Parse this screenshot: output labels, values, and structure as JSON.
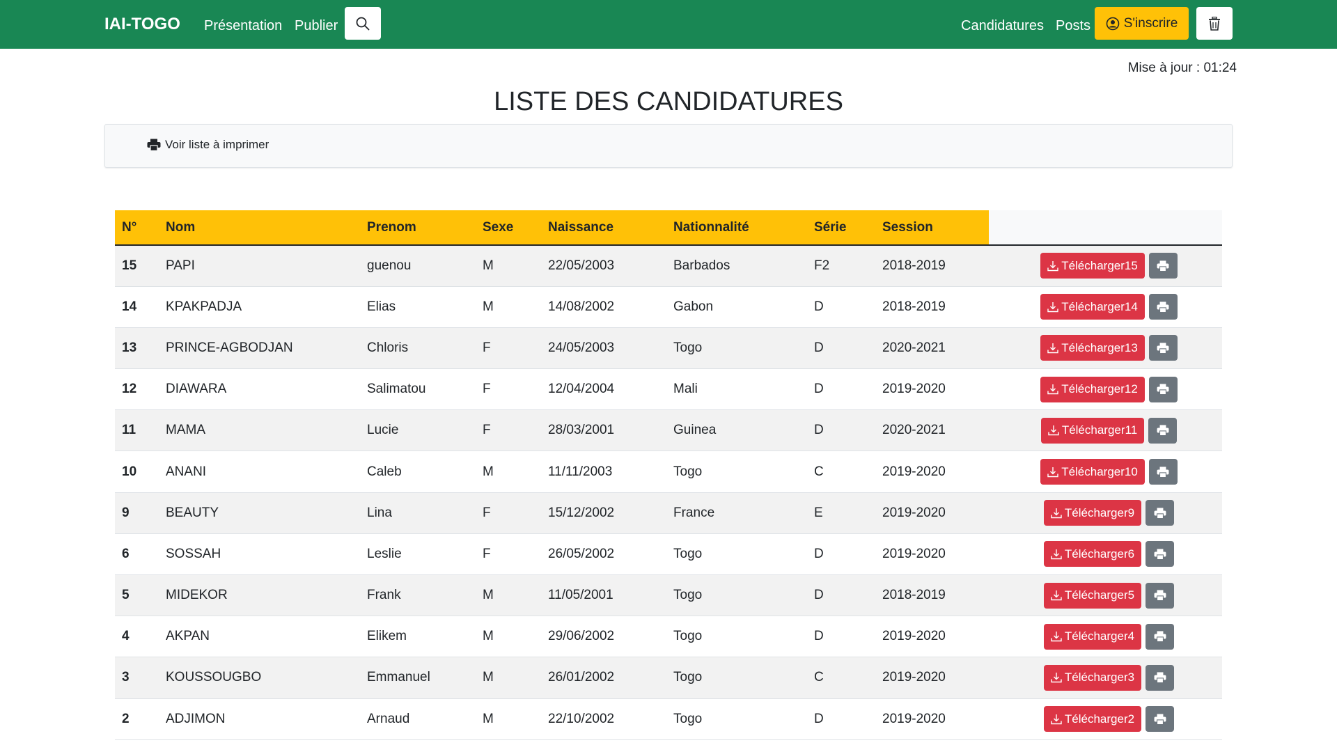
{
  "nav": {
    "brand": "IAI-TOGO",
    "presentation": "Présentation",
    "publier": "Publier",
    "candidatures": "Candidatures",
    "posts": "Posts",
    "signup": "S'inscrire"
  },
  "update_time": "Mise à jour : 01:24",
  "page_title": "LISTE DES CANDIDATURES",
  "print_list_label": "Voir liste à imprimer",
  "table": {
    "headers": [
      "N°",
      "Nom",
      "Prenom",
      "Sexe",
      "Naissance",
      "Nationnalité",
      "Série",
      "Session"
    ],
    "rows": [
      {
        "n": "15",
        "nom": "PAPI",
        "prenom": "guenou",
        "sexe": "M",
        "naissance": "22/05/2003",
        "nat": "Barbados",
        "serie": "F2",
        "session": "2018-2019",
        "dl": "Télécharger15"
      },
      {
        "n": "14",
        "nom": "KPAKPADJA",
        "prenom": "Elias",
        "sexe": "M",
        "naissance": "14/08/2002",
        "nat": "Gabon",
        "serie": "D",
        "session": "2018-2019",
        "dl": "Télécharger14"
      },
      {
        "n": "13",
        "nom": "PRINCE-AGBODJAN",
        "prenom": "Chloris",
        "sexe": "F",
        "naissance": "24/05/2003",
        "nat": "Togo",
        "serie": "D",
        "session": "2020-2021",
        "dl": "Télécharger13"
      },
      {
        "n": "12",
        "nom": "DIAWARA",
        "prenom": "Salimatou",
        "sexe": "F",
        "naissance": "12/04/2004",
        "nat": "Mali",
        "serie": "D",
        "session": "2019-2020",
        "dl": "Télécharger12"
      },
      {
        "n": "11",
        "nom": "MAMA",
        "prenom": "Lucie",
        "sexe": "F",
        "naissance": "28/03/2001",
        "nat": "Guinea",
        "serie": "D",
        "session": "2020-2021",
        "dl": "Télécharger11"
      },
      {
        "n": "10",
        "nom": "ANANI",
        "prenom": "Caleb",
        "sexe": "M",
        "naissance": "11/11/2003",
        "nat": "Togo",
        "serie": "C",
        "session": "2019-2020",
        "dl": "Télécharger10"
      },
      {
        "n": "9",
        "nom": "BEAUTY",
        "prenom": "Lina",
        "sexe": "F",
        "naissance": "15/12/2002",
        "nat": "France",
        "serie": "E",
        "session": "2019-2020",
        "dl": "Télécharger9"
      },
      {
        "n": "6",
        "nom": "SOSSAH",
        "prenom": "Leslie",
        "sexe": "F",
        "naissance": "26/05/2002",
        "nat": "Togo",
        "serie": "D",
        "session": "2019-2020",
        "dl": "Télécharger6"
      },
      {
        "n": "5",
        "nom": "MIDEKOR",
        "prenom": "Frank",
        "sexe": "M",
        "naissance": "11/05/2001",
        "nat": "Togo",
        "serie": "D",
        "session": "2018-2019",
        "dl": "Télécharger5"
      },
      {
        "n": "4",
        "nom": "AKPAN",
        "prenom": "Elikem",
        "sexe": "M",
        "naissance": "29/06/2002",
        "nat": "Togo",
        "serie": "D",
        "session": "2019-2020",
        "dl": "Télécharger4"
      },
      {
        "n": "3",
        "nom": "KOUSSOUGBO",
        "prenom": "Emmanuel",
        "sexe": "M",
        "naissance": "26/01/2002",
        "nat": "Togo",
        "serie": "C",
        "session": "2019-2020",
        "dl": "Télécharger3"
      },
      {
        "n": "2",
        "nom": "ADJIMON",
        "prenom": "Arnaud",
        "sexe": "M",
        "naissance": "22/10/2002",
        "nat": "Togo",
        "serie": "D",
        "session": "2019-2020",
        "dl": "Télécharger2"
      }
    ]
  },
  "icons": {
    "search": "search-icon",
    "user": "user-circle-icon",
    "trash": "trash-icon",
    "print": "printer-icon",
    "download": "download-icon"
  },
  "colors": {
    "navbar": "#198754",
    "header_highlight": "#ffc107",
    "download_button": "#dc3545",
    "print_button": "#6c757d"
  }
}
